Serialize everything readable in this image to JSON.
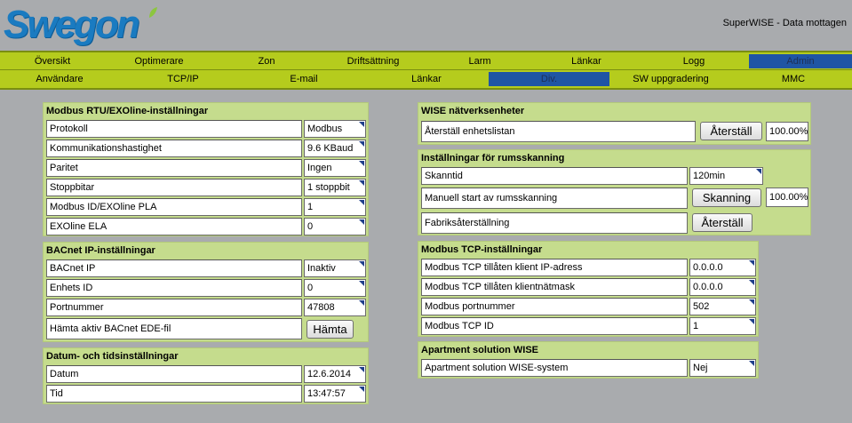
{
  "header": {
    "logo_text": "Swegon",
    "status": "SuperWISE - Data mottagen"
  },
  "nav_main": [
    "Översikt",
    "Optimerare",
    "Zon",
    "Driftsättning",
    "Larm",
    "Länkar",
    "Logg",
    "Admin"
  ],
  "nav_sub": [
    "Användare",
    "TCP/IP",
    "E-mail",
    "Länkar",
    "Div.",
    "SW uppgradering",
    "MMC"
  ],
  "modbus": {
    "title": "Modbus RTU/EXOline-inställningar",
    "rows": [
      {
        "label": "Protokoll",
        "value": "Modbus"
      },
      {
        "label": "Kommunikationshastighet",
        "value": "9.6 KBaud"
      },
      {
        "label": "Paritet",
        "value": "Ingen"
      },
      {
        "label": "Stoppbitar",
        "value": "1 stoppbit"
      },
      {
        "label": "Modbus ID/EXOline PLA",
        "value": "1"
      },
      {
        "label": "EXOline ELA",
        "value": "0"
      }
    ]
  },
  "bacnet": {
    "title": "BACnet IP-inställningar",
    "rows": [
      {
        "label": "BACnet IP",
        "value": "Inaktiv"
      },
      {
        "label": "Enhets ID",
        "value": "0"
      },
      {
        "label": "Portnummer",
        "value": "47808"
      }
    ],
    "ede_label": "Hämta aktiv BACnet EDE-fil",
    "ede_button": "Hämta"
  },
  "datetime": {
    "title": "Datum- och tidsinställningar",
    "rows": [
      {
        "label": "Datum",
        "value": "12.6.2014"
      },
      {
        "label": "Tid",
        "value": "13:47:57"
      }
    ]
  },
  "wise_net": {
    "title": "WISE nätverksenheter",
    "reset_label": "Återställ enhetslistan",
    "reset_button": "Återställ",
    "progress": "100.00%"
  },
  "roomscan": {
    "title": "Inställningar för rumsskanning",
    "scantime_label": "Skanntid",
    "scantime_value": "120min",
    "manual_label": "Manuell start av rumsskanning",
    "manual_button": "Skanning",
    "manual_progress": "100.00%",
    "factory_label": "Fabriksåterställning",
    "factory_button": "Återställ"
  },
  "modbus_tcp": {
    "title": "Modbus TCP-inställningar",
    "rows": [
      {
        "label": "Modbus TCP tillåten klient IP-adress",
        "value": "0.0.0.0"
      },
      {
        "label": "Modbus TCP tillåten klientnätmask",
        "value": "0.0.0.0"
      },
      {
        "label": "Modbus portnummer",
        "value": "502"
      },
      {
        "label": "Modbus TCP ID",
        "value": "1"
      }
    ]
  },
  "apartment": {
    "title": "Apartment solution WISE",
    "label": "Apartment solution WISE-system",
    "value": "Nej"
  },
  "colors": {
    "logo_blue": "#1a7bc1",
    "nav_green": "#b5cc1d",
    "panel_green": "#c5dc8d",
    "active_blue": "#1f55a4",
    "background": "#a9abae"
  }
}
